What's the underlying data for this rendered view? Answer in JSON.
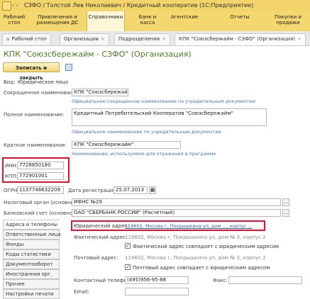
{
  "window": {
    "title": "СЗФО / Толстой Лев Николаевич / Кредитный кооператив (1С:Предприятие)"
  },
  "menu": [
    {
      "label": "Рабочий\nстол"
    },
    {
      "label": "Привлечения и\nразмещения ДС"
    },
    {
      "label": "Справочники"
    },
    {
      "label": "Банк и\nкасса"
    },
    {
      "label": "Агентские"
    },
    {
      "label": "Отчеты"
    },
    {
      "label": "Покупки и\nпродажи"
    }
  ],
  "tabs": [
    {
      "label": "Рабочий стол"
    },
    {
      "label": "Организации"
    },
    {
      "label": "Подразделения"
    },
    {
      "label": "КПК \"Союзсбержайм - СЗФО\" (Организация)"
    }
  ],
  "form": {
    "title": "КПК \"Союзсбережайм - СЗФО\" (Организация)",
    "save_close": "Записать и закрыть",
    "kind_label": "Вид:",
    "kind_value": "Юридическое лицо",
    "short_name_label": "Сокращенное наименование:",
    "short_name_value": "КПК \"Союзсбережайм\"",
    "short_name_hint": "Официальное сокращенное наименование по учредительным документам",
    "full_name_label": "Полное наименование:",
    "full_name_value": "Кредитный Потребительский Кооператив \"Союзсбережайм\"",
    "full_name_hint": "Официальное наименование по учредительным документам",
    "brief_name_label": "Краткое наименование:",
    "brief_name_value": "КПК \"Союзсбережайм\"",
    "brief_name_hint": "Наименование, используемое для отражения в программе",
    "inn_label": "ИНН:",
    "inn_value": "7728850180",
    "kpp_label": "КПП:",
    "kpp_value": "772901001",
    "ogrn_label": "ОГРН:",
    "ogrn_value": "1137746632209",
    "reg_date_label": "Дата регистрации:",
    "reg_date_value": "25.07.2013",
    "tax_label": "Налоговый орган (основной):",
    "tax_value": "ИФНС №29",
    "bank_label": "Банковский счет (основной):",
    "bank_value": "ОАО \"СБЕРБАНК РОССИИ\" (Расчетный)"
  },
  "side_tabs": [
    {
      "label": "Адреса и телефоны"
    },
    {
      "label": "Ответственные лица"
    },
    {
      "label": "Фонды"
    },
    {
      "label": "Коды статистики"
    },
    {
      "label": "Документооборот"
    },
    {
      "label": "Иностранная орг."
    },
    {
      "label": "Прочее"
    },
    {
      "label": "Настройки печати"
    }
  ],
  "addresses": {
    "legal_label": "Юридический адрес:",
    "legal_value": "119602, Москва г, Покрышкина ул, дом ..., корпус ...",
    "actual_label": "Фактический адрес:",
    "actual_value": "119602, Москва г, Покрышкина ул, дом № 3, корпус 2",
    "actual_same_label": "Фактический адрес совпадает с юридическим адресом",
    "postal_label": "Почтовый адрес:",
    "postal_value": "119602, Москва г, Покрышкина ул, дом № 3, корпус 2",
    "postal_same_label": "Почтовый адрес совпадает с юридическим адресом",
    "phone_label": "Контактный телефон:",
    "phone_value": "(495)956-95-88",
    "fax_label": "Факс:",
    "fax_value": "",
    "email_label": "Email:",
    "email_value": ""
  },
  "colors": {
    "title_green": "#4c7b22",
    "highlight_red": "#e3102f",
    "menu_yellow": "#f4d76f"
  }
}
